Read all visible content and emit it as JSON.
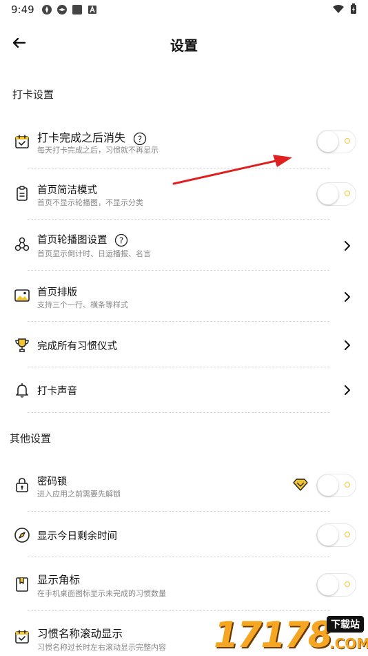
{
  "status": {
    "time": "9:49"
  },
  "header": {
    "title": "设置"
  },
  "sections": {
    "checkin": "打卡设置",
    "other": "其他设置"
  },
  "rows": [
    {
      "label": "打卡完成之后消失",
      "sub": "每天打卡完成之后，习惯就不再显示",
      "icon": "calendar-check-icon"
    },
    {
      "label": "首页简洁模式",
      "sub": "首页不显示轮播图，不显示分类",
      "icon": "clipboard-icon"
    },
    {
      "label": "首页轮播图设置",
      "sub": "首页显示倒计时、日运播报、名言",
      "icon": "circles-icon"
    },
    {
      "label": "首页排版",
      "sub": "支持三个一行、横条等样式",
      "icon": "image-icon"
    },
    {
      "label": "完成所有习惯仪式",
      "icon": "trophy-icon"
    },
    {
      "label": "打卡声音",
      "icon": "bell-icon"
    },
    {
      "label": "密码锁",
      "sub": "进入应用之前需要先解锁",
      "icon": "lock-icon"
    },
    {
      "label": "显示今日剩余时间",
      "icon": "compass-icon"
    },
    {
      "label": "显示角标",
      "sub": "在手机桌面图标显示未完成的习惯数量",
      "icon": "bookmark-icon"
    },
    {
      "label": "习惯名称滚动显示",
      "sub": "习惯名称过长时左右滚动显示完整内容",
      "icon": "calendar-check-icon"
    }
  ],
  "watermark": {
    "text": "17178",
    "badge": "下载站",
    "domain": ".COM"
  },
  "colors": {
    "accent": "#f2c530",
    "arrow": "#e02020"
  }
}
